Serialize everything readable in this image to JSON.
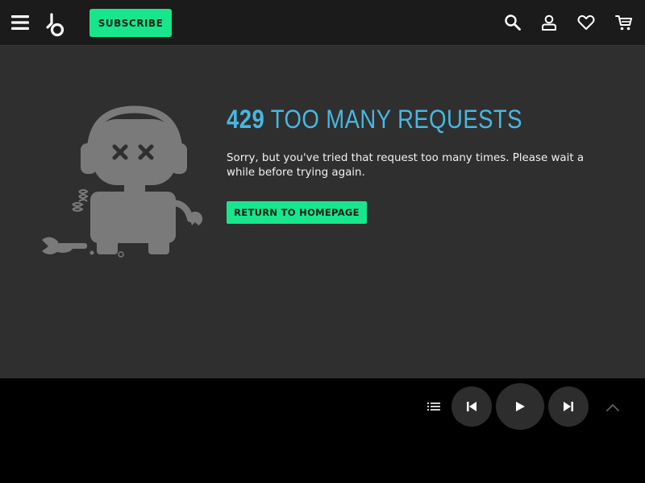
{
  "header": {
    "subscribe_label": "SUBSCRIBE",
    "icons": [
      "menu-icon",
      "beatport-logo",
      "search-icon",
      "account-icon",
      "heart-icon",
      "cart-icon"
    ]
  },
  "error": {
    "code": "429",
    "title": "TOO MANY REQUESTS",
    "message": "Sorry, but you've tried that request too many times. Please wait a while before trying again.",
    "button_label": "RETURN TO HOMEPAGE",
    "illustration": "broken-robot-illustration"
  },
  "player": {
    "icons": [
      "queue-icon",
      "previous-icon",
      "play-icon",
      "next-icon",
      "chevron-up-icon"
    ]
  },
  "colors": {
    "accent_green": "#19e68c",
    "heading_blue": "#47b8e0",
    "background": "#2f2f2f",
    "topbar": "#1b1b1b",
    "player": "#000000"
  }
}
